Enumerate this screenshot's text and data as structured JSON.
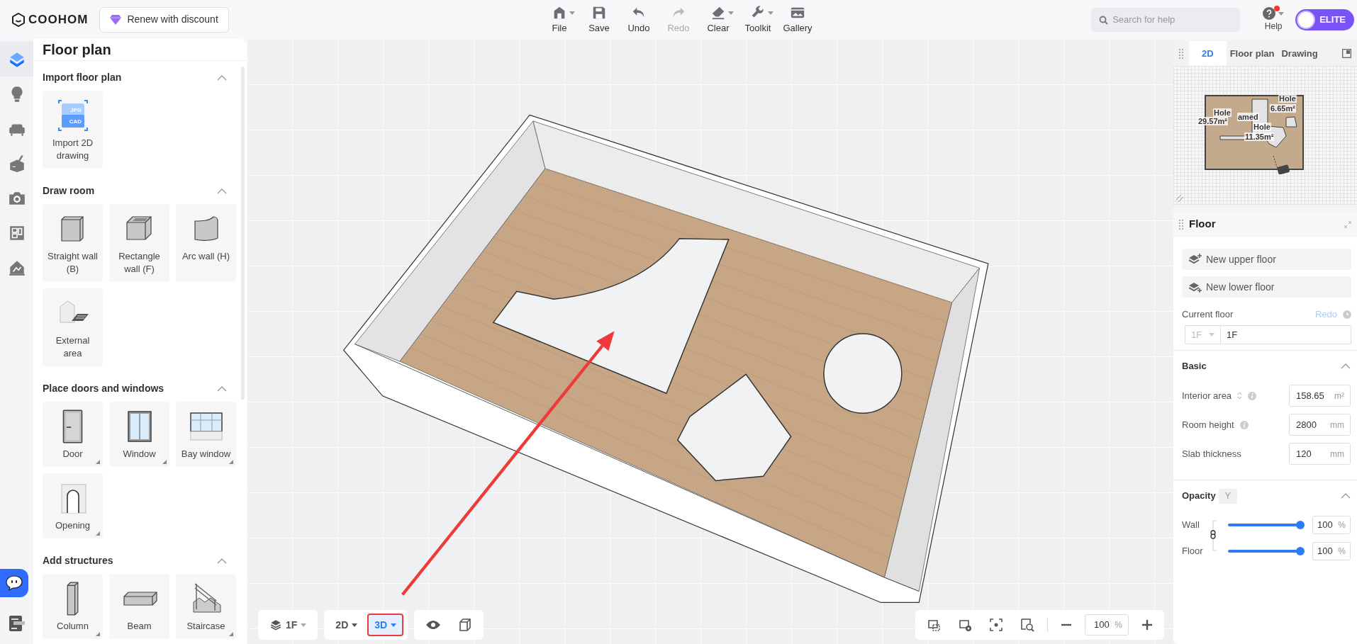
{
  "top_bar": {
    "logo": "COOHOM",
    "promo_button": "Renew with discount",
    "tools": [
      {
        "label": "File",
        "has_menu": true,
        "disabled": false
      },
      {
        "label": "Save",
        "has_menu": false,
        "disabled": false
      },
      {
        "label": "Undo",
        "has_menu": false,
        "disabled": false
      },
      {
        "label": "Redo",
        "has_menu": false,
        "disabled": true
      },
      {
        "label": "Clear",
        "has_menu": true,
        "disabled": false
      },
      {
        "label": "Toolkit",
        "has_menu": true,
        "disabled": false
      },
      {
        "label": "Gallery",
        "has_menu": false,
        "disabled": false
      }
    ],
    "search": {
      "placeholder": "Search for help"
    },
    "help": {
      "label": "Help",
      "notification": true,
      "has_menu": true
    },
    "plan_badge": "ELITE"
  },
  "rail": {
    "items": [
      {
        "selected": true
      },
      {
        "selected": false
      },
      {
        "selected": false
      },
      {
        "selected": false
      },
      {
        "selected": false
      },
      {
        "selected": false
      },
      {
        "selected": false
      }
    ]
  },
  "left_panel": {
    "title": "Floor plan",
    "sections": [
      {
        "title": "Import floor plan",
        "expanded": true,
        "items": [
          {
            "label": "Import 2D drawing",
            "has_options": false,
            "icon_text": [
              "JPG",
              "CAD"
            ]
          }
        ]
      },
      {
        "title": "Draw room",
        "expanded": true,
        "items": [
          {
            "label": "Straight wall (B)",
            "has_options": false
          },
          {
            "label": "Rectangle wall (F)",
            "has_options": false
          },
          {
            "label": "Arc wall (H)",
            "has_options": false
          },
          {
            "label": "External area",
            "has_options": false
          }
        ]
      },
      {
        "title": "Place doors and windows",
        "expanded": true,
        "items": [
          {
            "label": "Door",
            "has_options": true
          },
          {
            "label": "Window",
            "has_options": true
          },
          {
            "label": "Bay window",
            "has_options": true
          },
          {
            "label": "Opening",
            "has_options": true
          }
        ]
      },
      {
        "title": "Add structures",
        "expanded": true,
        "items": [
          {
            "label": "Column",
            "has_options": true
          },
          {
            "label": "Beam",
            "has_options": false
          },
          {
            "label": "Staircase",
            "has_options": true
          }
        ]
      }
    ]
  },
  "canvas": {
    "floor_selector": "1F",
    "view_modes": [
      {
        "label": "2D",
        "selected": false,
        "highlighted": false
      },
      {
        "label": "3D",
        "selected": true,
        "highlighted": true
      }
    ],
    "zoom": {
      "value": "100",
      "unit": "%"
    }
  },
  "minimap": {
    "tabs": [
      {
        "label": "2D",
        "selected": true
      },
      {
        "label": "Floor plan",
        "selected": false
      },
      {
        "label": "Drawing",
        "selected": false
      }
    ],
    "labels": [
      "Hole",
      "29.57m²",
      "amed",
      "Hole",
      "6.65m²",
      "Hole",
      "11.35m²"
    ]
  },
  "properties": {
    "title": "Floor",
    "buttons": [
      "New upper floor",
      "New lower floor"
    ],
    "current_floor": {
      "label": "Current floor",
      "action": "Redo",
      "action_disabled": true,
      "floor_select": "1F",
      "floor_name": "1F"
    },
    "basic": {
      "title": "Basic",
      "expanded": true,
      "fields": [
        {
          "label": "Interior area",
          "value": "158.65",
          "unit": "m²",
          "sortable": true,
          "info": true
        },
        {
          "label": "Room height",
          "value": "2800",
          "unit": "mm",
          "sortable": false,
          "info": true
        },
        {
          "label": "Slab thickness",
          "value": "120",
          "unit": "mm",
          "sortable": false,
          "info": false
        }
      ]
    },
    "opacity": {
      "title": "Opacity",
      "toggle": "Y",
      "expanded": true,
      "linked": true,
      "sliders": [
        {
          "label": "Wall",
          "level": 1,
          "value": "100",
          "unit": "%"
        },
        {
          "label": "Floor",
          "level": 1,
          "value": "100",
          "unit": "%"
        }
      ]
    }
  }
}
